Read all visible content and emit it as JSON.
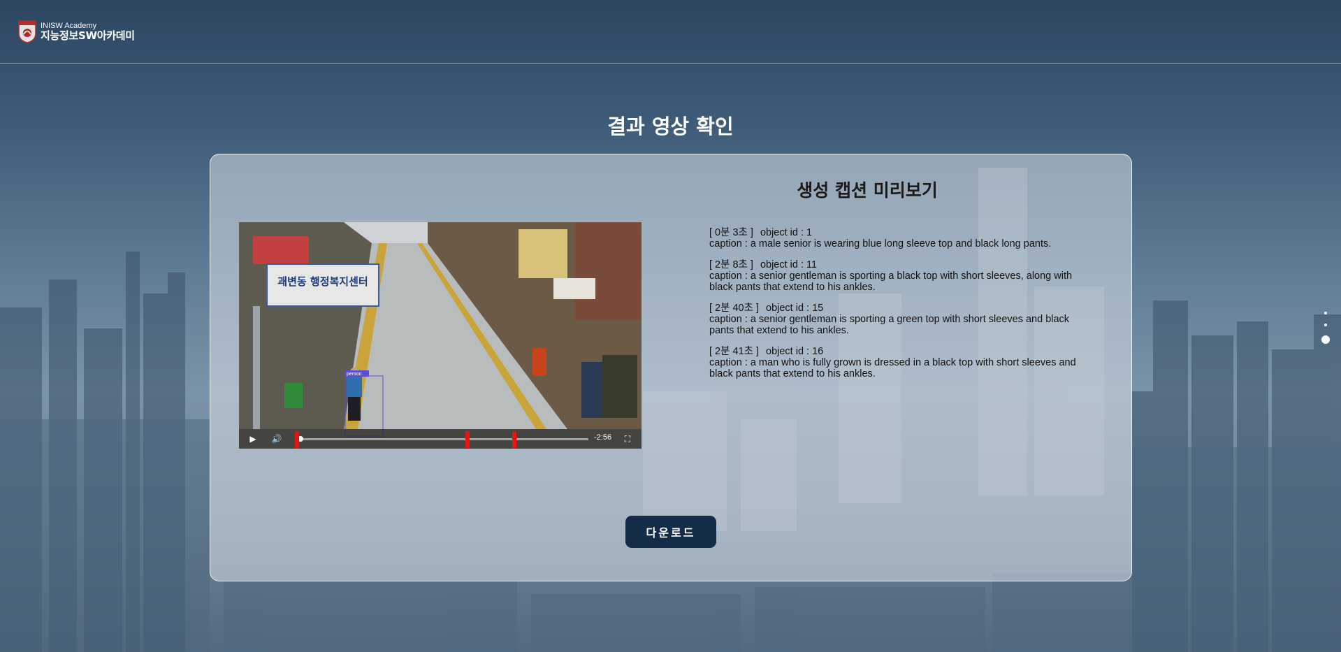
{
  "header": {
    "logo_en": "INISW Academy",
    "logo_ko": "지능정보SW아카데미"
  },
  "page_title": "결과 영상 확인",
  "caption_heading": "생성 캡션 미리보기",
  "video": {
    "time_remaining": "-2:56",
    "sign_text": "괘변동 행정복지센터",
    "bbox_label": "person",
    "playback_progress": 0.01,
    "markers": [
      0.0,
      0.58,
      0.74
    ]
  },
  "captions": [
    {
      "time": "[ 0분 3초 ]",
      "object": "object id : 1",
      "caption": "caption : a male senior is wearing blue long sleeve top and black long pants."
    },
    {
      "time": "[ 2분 8초 ]",
      "object": "object id : 11",
      "caption": "caption : a senior gentleman is sporting a black top with short sleeves, along with black pants that extend to his ankles."
    },
    {
      "time": "[ 2분 40초 ]",
      "object": "object id : 15",
      "caption": "caption : a senior gentleman is sporting a green top with short sleeves and black pants that extend to his ankles."
    },
    {
      "time": "[ 2분 41초 ]",
      "object": "object id : 16",
      "caption": "caption : a man who is fully grown is dressed in a black top with short sleeves and black pants that extend to his ankles."
    }
  ],
  "download_label": "다운로드",
  "page_dots": {
    "count": 3,
    "active_index": 2
  },
  "colors": {
    "button_bg": "#142c48",
    "marker": "#ee1111",
    "panel_border": "#ffffff"
  }
}
